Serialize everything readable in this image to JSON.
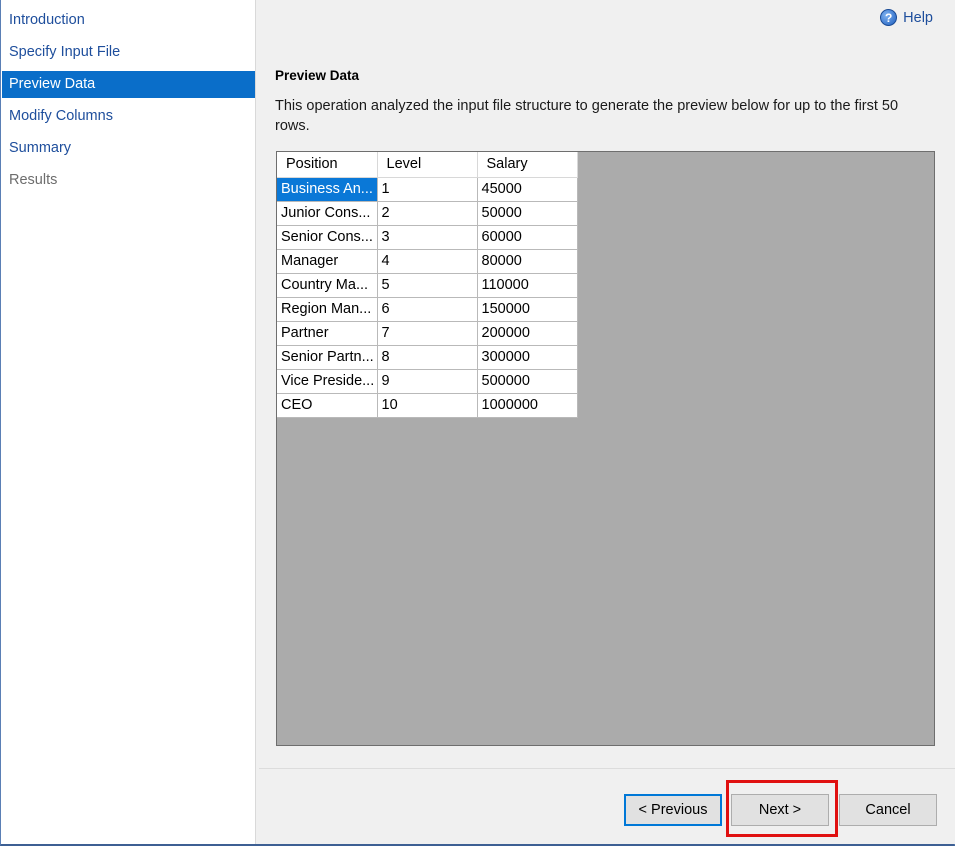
{
  "sidebar": {
    "items": [
      {
        "label": "Introduction",
        "state": "link"
      },
      {
        "label": "Specify Input File",
        "state": "link"
      },
      {
        "label": "Preview Data",
        "state": "active"
      },
      {
        "label": "Modify Columns",
        "state": "link"
      },
      {
        "label": "Summary",
        "state": "link"
      },
      {
        "label": "Results",
        "state": "disabled"
      }
    ]
  },
  "header": {
    "help_label": "Help",
    "help_icon": "question-circle-icon"
  },
  "main": {
    "title": "Preview Data",
    "description": "This operation analyzed the input file structure to generate the preview below for up to the first 50 rows."
  },
  "table": {
    "columns": [
      "Position",
      "Level",
      "Salary"
    ],
    "rows": [
      [
        "Business An...",
        "1",
        "45000"
      ],
      [
        "Junior Cons...",
        "2",
        "50000"
      ],
      [
        "Senior Cons...",
        "3",
        "60000"
      ],
      [
        "Manager",
        "4",
        "80000"
      ],
      [
        "Country Ma...",
        "5",
        "110000"
      ],
      [
        "Region Man...",
        "6",
        "150000"
      ],
      [
        "Partner",
        "7",
        "200000"
      ],
      [
        "Senior Partn...",
        "8",
        "300000"
      ],
      [
        "Vice Preside...",
        "9",
        "500000"
      ],
      [
        "CEO",
        "10",
        "1000000"
      ]
    ],
    "selected_cell": "Business An..."
  },
  "footer": {
    "previous_label": "< Previous",
    "next_label": "Next >",
    "cancel_label": "Cancel"
  },
  "colors": {
    "accent": "#0a6ec9",
    "selection": "#0a78d7",
    "link": "#1e4e9c",
    "highlight_box": "#e01010"
  }
}
